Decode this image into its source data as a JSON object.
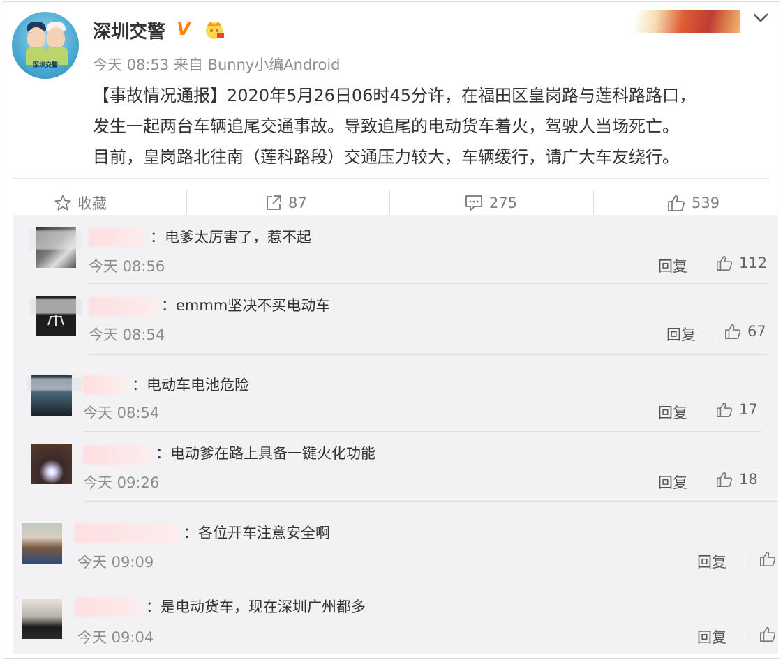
{
  "post": {
    "author": "深圳交警",
    "verified_badge": "V",
    "avatar_caption": "深圳交警",
    "meta": "今天 08:53 来自 Bunny小编Android",
    "content": "【事故情况通报】2020年5月26日06时45分许，在福田区皇岗路与莲科路路口，发生一起两台车辆追尾交通事故。导致追尾的电动货车着火，驾驶人当场死亡。目前，皇岗路北往南（莲科路段）交通压力较大，车辆缓行，请广大车友绕行。",
    "content_lines": [
      "【事故情况通报】2020年5月26日06时45分许，在福田区皇岗路与莲科路路口，",
      "发生一起两台车辆追尾交通事故。导致追尾的电动货车着火，驾驶人当场死亡。",
      "目前，皇岗路北往南（莲科路段）交通压力较大，车辆缓行，请广大车友绕行。"
    ]
  },
  "actions": {
    "favorite": {
      "label": "收藏",
      "icon": "star-icon"
    },
    "repost": {
      "count": "87",
      "icon": "share-icon"
    },
    "comment": {
      "count": "275",
      "icon": "comment-icon"
    },
    "like": {
      "count": "539",
      "icon": "thumb-up-icon"
    }
  },
  "comments": [
    {
      "text": "：电爹太厉害了，惹不起",
      "time": "今天 08:56",
      "reply": "回复",
      "likes": "112"
    },
    {
      "text": "：emmm坚决不买电动车",
      "name_visible": "g",
      "time": "今天 08:54",
      "reply": "回复",
      "likes": "67"
    },
    {
      "text": "：电动车电池危险",
      "time": "今天 08:54",
      "reply": "回复",
      "likes": "17"
    },
    {
      "text": "：电动爹在路上具备一键火化功能",
      "time": "今天 09:26",
      "reply": "回复",
      "likes": "18"
    },
    {
      "text": "：各位开车注意安全啊",
      "time": "今天 09:09",
      "reply": "回复",
      "likes": ""
    },
    {
      "text": "：是电动货车，现在深圳广州都多",
      "time": "今天 09:04",
      "reply": "回复",
      "likes": ""
    }
  ],
  "colors": {
    "accent_name": "#eb7350",
    "verified": "#ff8200",
    "comment_bg": "#f2f2f5"
  }
}
